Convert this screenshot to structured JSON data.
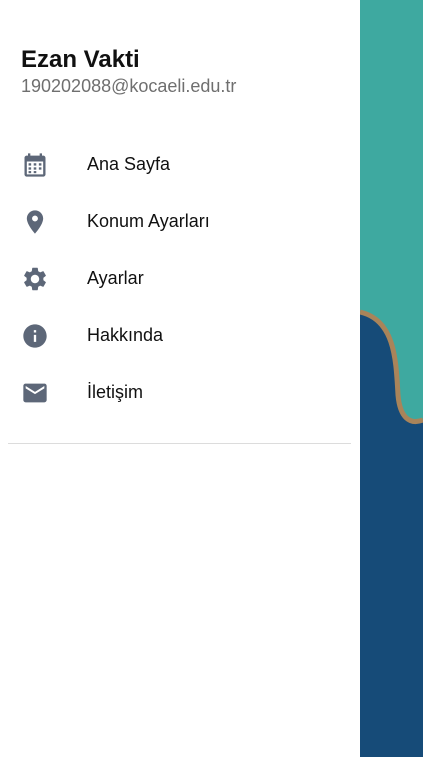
{
  "colors": {
    "teal": "#3ea9a0",
    "navy": "#164b78",
    "accent_curve": "#a9845a",
    "icon": "#5d6778"
  },
  "drawer": {
    "title": "Ezan Vakti",
    "email": "190202088@kocaeli.edu.tr"
  },
  "menu": {
    "items": [
      {
        "label": "Ana Sayfa",
        "icon": "calendar-icon"
      },
      {
        "label": "Konum Ayarları",
        "icon": "location-pin-icon"
      },
      {
        "label": "Ayarlar",
        "icon": "gear-icon"
      },
      {
        "label": "Hakkında",
        "icon": "info-icon"
      },
      {
        "label": "İletişim",
        "icon": "mail-icon"
      }
    ]
  }
}
